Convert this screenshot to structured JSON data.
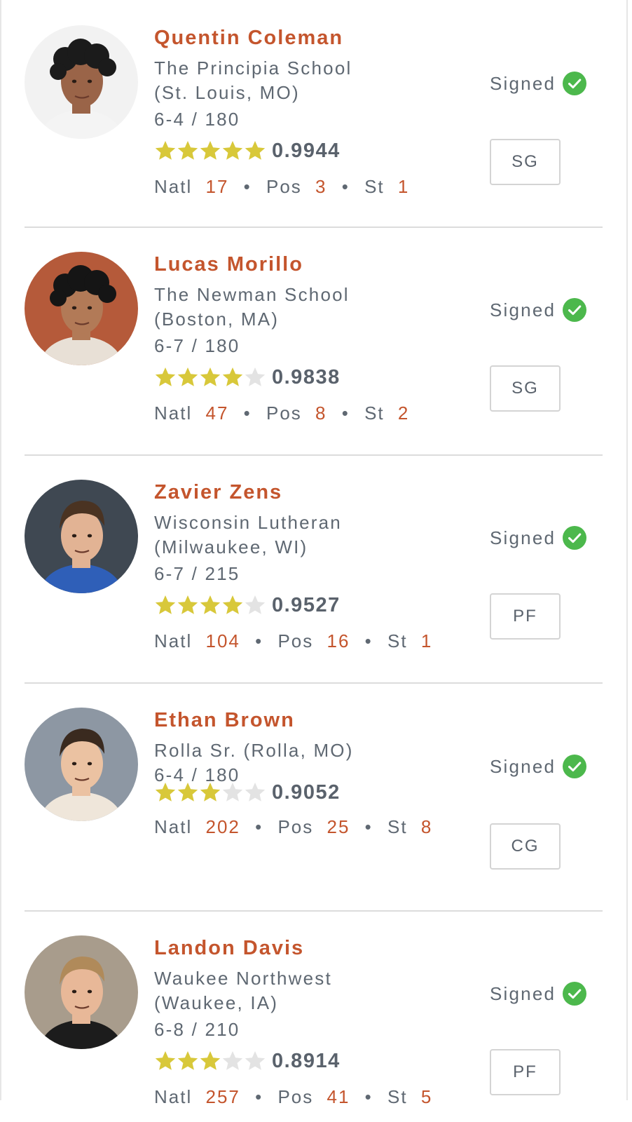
{
  "players": [
    {
      "name": "Quentin Coleman",
      "school_lines": [
        "The Principia School",
        "(St. Louis, MO)"
      ],
      "measurements": "6-4 / 180",
      "stars": 5,
      "rating": "0.9944",
      "ranks": {
        "natl_label": "Natl",
        "natl": "17",
        "pos_label": "Pos",
        "pos": "3",
        "st_label": "St",
        "st": "1"
      },
      "status": "Signed",
      "position": "SG",
      "avatar": {
        "bg": "#f2f2f2",
        "skin": "#9a6448",
        "hair": "#1b1b1b",
        "shirt": "#f4f4f4",
        "hair_style": "curly"
      }
    },
    {
      "name": "Lucas Morillo",
      "school_lines": [
        "The Newman School",
        "(Boston, MA)"
      ],
      "measurements": "6-7 / 180",
      "stars": 4,
      "rating": "0.9838",
      "ranks": {
        "natl_label": "Natl",
        "natl": "47",
        "pos_label": "Pos",
        "pos": "8",
        "st_label": "St",
        "st": "2"
      },
      "status": "Signed",
      "position": "SG",
      "avatar": {
        "bg": "#b55a3a",
        "skin": "#b27a57",
        "hair": "#151515",
        "shirt": "#e8e0d6",
        "hair_style": "curly"
      }
    },
    {
      "name": "Zavier Zens",
      "school_lines": [
        "Wisconsin Lutheran",
        "(Milwaukee, WI)"
      ],
      "measurements": "6-7 / 215",
      "stars": 4,
      "rating": "0.9527",
      "ranks": {
        "natl_label": "Natl",
        "natl": "104",
        "pos_label": "Pos",
        "pos": "16",
        "st_label": "St",
        "st": "1"
      },
      "status": "Signed",
      "position": "PF",
      "avatar": {
        "bg": "#3f4852",
        "skin": "#e2b394",
        "hair": "#4a3322",
        "shirt": "#2f5fb8",
        "hair_style": "short"
      }
    },
    {
      "name": "Ethan Brown",
      "school_lines": [
        "Rolla Sr. (Rolla, MO)"
      ],
      "measurements": "6-4 / 180",
      "stars": 3,
      "rating": "0.9052",
      "ranks": {
        "natl_label": "Natl",
        "natl": "202",
        "pos_label": "Pos",
        "pos": "25",
        "st_label": "St",
        "st": "8"
      },
      "status": "Signed",
      "position": "CG",
      "avatar": {
        "bg": "#8d97a3",
        "skin": "#ebc2a2",
        "hair": "#3a2a1f",
        "shirt": "#efe6da",
        "hair_style": "short"
      }
    },
    {
      "name": "Landon Davis",
      "school_lines": [
        "Waukee Northwest",
        "(Waukee, IA)"
      ],
      "measurements": "6-8 / 210",
      "stars": 3,
      "rating": "0.8914",
      "ranks": {
        "natl_label": "Natl",
        "natl": "257",
        "pos_label": "Pos",
        "pos": "41",
        "st_label": "St",
        "st": "5"
      },
      "status": "Signed",
      "position": "PF",
      "avatar": {
        "bg": "#a89c8c",
        "skin": "#e8b898",
        "hair": "#b08a5a",
        "shirt": "#1c1c1c",
        "hair_style": "short"
      }
    }
  ],
  "colors": {
    "name": "#c4552d",
    "rank_number": "#c4552d",
    "star_filled": "#d8c83a",
    "star_empty": "#e3e3e3",
    "check": "#4cb84c",
    "text": "#5f6872"
  },
  "icons": {
    "star": "star-icon",
    "check": "check-circle-icon"
  }
}
